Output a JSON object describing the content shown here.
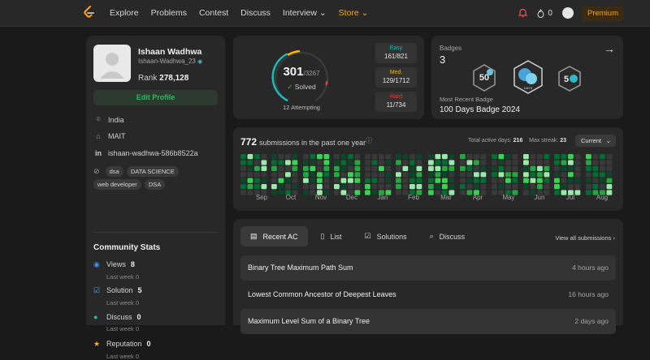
{
  "nav": {
    "links": [
      "Explore",
      "Problems",
      "Contest",
      "Discuss",
      "Interview ⌄",
      "Store ⌄"
    ],
    "streak_count": "0",
    "premium_label": "Premium"
  },
  "profile": {
    "name": "Ishaan Wadhwa",
    "username": "Ishaan-Wadhwa_23",
    "rank_label": "Rank",
    "rank_value": "278,128",
    "edit_label": "Edit Profile",
    "location": "India",
    "school": "MAIT",
    "linkedin": "ishaan-wadhwa-586b8522a",
    "tags": [
      "dsa",
      "DATA SCIENCE",
      "web developer",
      "DSA"
    ]
  },
  "community": {
    "title": "Community Stats",
    "stats": [
      {
        "label": "Views",
        "value": "8",
        "sub": "Last week 0",
        "icon": "eye-icon",
        "color": "#3b8ff6"
      },
      {
        "label": "Solution",
        "value": "5",
        "sub": "Last week 0",
        "icon": "solution-check-icon",
        "color": "#4fa8e8"
      },
      {
        "label": "Discuss",
        "value": "0",
        "sub": "Last week 0",
        "icon": "discuss-bubble-icon",
        "color": "#2cbb9b"
      },
      {
        "label": "Reputation",
        "value": "0",
        "sub": "Last week 0",
        "icon": "reputation-star-icon",
        "color": "#ffb800"
      }
    ]
  },
  "solved": {
    "count": "301",
    "total": "/3267",
    "label": "Solved",
    "attempting": "12 Attempting",
    "difficulties": [
      {
        "label": "Easy",
        "count": "161/821",
        "color": "#1cbaba"
      },
      {
        "label": "Med.",
        "count": "129/1712",
        "color": "#ffb700"
      },
      {
        "label": "Hard",
        "count": "11/734",
        "color": "#f63737"
      }
    ]
  },
  "badges": {
    "title": "Badges",
    "count": "3",
    "recent_label": "Most Recent Badge",
    "recent_name": "100 Days Badge 2024"
  },
  "submissions": {
    "count": "772",
    "text": "submissions in the past one year",
    "active_label": "Total active days:",
    "active_value": "216",
    "streak_label": "Max streak:",
    "streak_value": "23",
    "select_value": "Current",
    "months": [
      "Sep",
      "Oct",
      "Nov",
      "Dec",
      "Jan",
      "Feb",
      "Mar",
      "Apr",
      "May",
      "Jun",
      "Jul",
      "Aug"
    ]
  },
  "recent": {
    "tabs": [
      "Recent AC",
      "List",
      "Solutions",
      "Discuss"
    ],
    "view_all": "View all submissions",
    "items": [
      {
        "title": "Binary Tree Maximum Path Sum",
        "time": "4 hours ago"
      },
      {
        "title": "Lowest Common Ancestor of Deepest Leaves",
        "time": "16 hours ago"
      },
      {
        "title": "Maximum Level Sum of a Binary Tree",
        "time": "2 days ago"
      }
    ]
  },
  "colors": {
    "accent": "#ffa116",
    "green": "#2cbb5d"
  }
}
